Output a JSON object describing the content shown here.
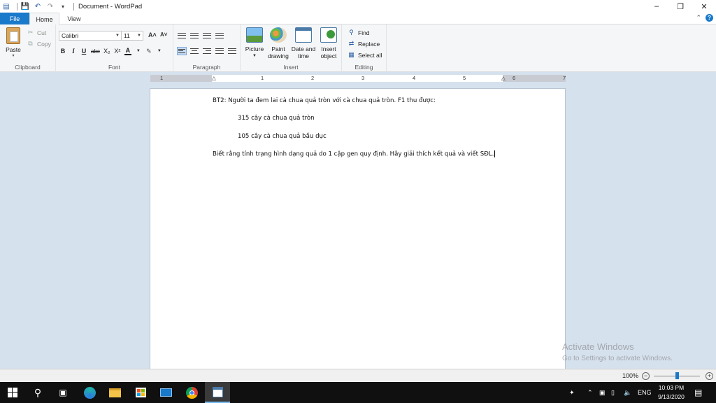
{
  "window": {
    "title": "Document - WordPad",
    "minimize": "–",
    "restore": "❐",
    "close": "✕"
  },
  "tabs": {
    "file": "File",
    "home": "Home",
    "view": "View"
  },
  "ribbon": {
    "clipboard": {
      "label": "Clipboard",
      "paste": "Paste",
      "cut": "Cut",
      "copy": "Copy"
    },
    "font": {
      "label": "Font",
      "family": "Calibri",
      "size": "11",
      "grow": "A˄",
      "shrink": "A˅",
      "bold": "B",
      "italic": "I",
      "underline": "U",
      "strike": "abc",
      "subscript": "X₂",
      "superscript": "X²",
      "color": "A"
    },
    "paragraph": {
      "label": "Paragraph"
    },
    "insert": {
      "label": "Insert",
      "picture": "Picture",
      "paint_line1": "Paint",
      "paint_line2": "drawing",
      "date_line1": "Date and",
      "date_line2": "time",
      "object_line1": "Insert",
      "object_line2": "object"
    },
    "editing": {
      "label": "Editing",
      "find": "Find",
      "replace": "Replace",
      "select_all": "Select all"
    }
  },
  "ruler": {
    "ticks": [
      "1",
      "1",
      "2",
      "3",
      "4",
      "5",
      "6",
      "7"
    ]
  },
  "document": {
    "line1": "BT2: Người ta đem lai cà chua quả tròn với cà chua quả tròn. F1 thu được:",
    "line2": "315  cây cà chua quả tròn",
    "line3": "105  cây cà chua quả bầu dục",
    "line4": "Biết rằng tính trạng hình dạng quả do 1 cặp gen quy định. Hãy giải thích kết quả và viết SĐL."
  },
  "watermark": {
    "line1": "Activate Windows",
    "line2": "Go to Settings to activate Windows."
  },
  "status": {
    "zoom": "100%"
  },
  "taskbar": {
    "language": "ENG",
    "time": "10:03 PM",
    "date": "9/13/2020"
  },
  "colors": {
    "accent": "#1979ca",
    "page_bg": "#d6e1ee",
    "taskbar": "#101010"
  }
}
